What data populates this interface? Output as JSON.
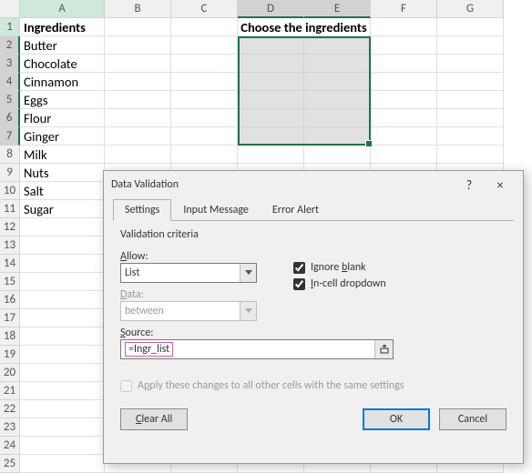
{
  "columns": [
    "A",
    "B",
    "C",
    "D",
    "E",
    "F",
    "G"
  ],
  "rows": [
    "1",
    "2",
    "3",
    "4",
    "5",
    "6",
    "7",
    "8",
    "9",
    "10",
    "11",
    "12",
    "13",
    "14",
    "15",
    "16",
    "17",
    "18",
    "19",
    "20",
    "21",
    "22",
    "23",
    "24",
    "25"
  ],
  "header_a": "Ingredients",
  "header_de": "Choose the ingredients",
  "ingredients": [
    "Butter",
    "Chocolate",
    "Cinnamon",
    "Eggs",
    "Flour",
    "Ginger",
    "Milk",
    "Nuts",
    "Salt",
    "Sugar"
  ],
  "dialog": {
    "title": "Data Validation",
    "help": "?",
    "close": "×",
    "tabs": {
      "settings": "Settings",
      "input": "Input Message",
      "error": "Error Alert"
    },
    "group": "Validation criteria",
    "allow_label": "Allow:",
    "allow_value": "List",
    "data_label": "Data:",
    "data_value": "between",
    "ignore_blank": "Ignore blank",
    "incell": "In-cell dropdown",
    "source_label": "Source:",
    "source_value": "=Ingr_list",
    "apply": "Apply these changes to all other cells with the same settings",
    "clear": "Clear All",
    "ok": "OK",
    "cancel": "Cancel"
  }
}
